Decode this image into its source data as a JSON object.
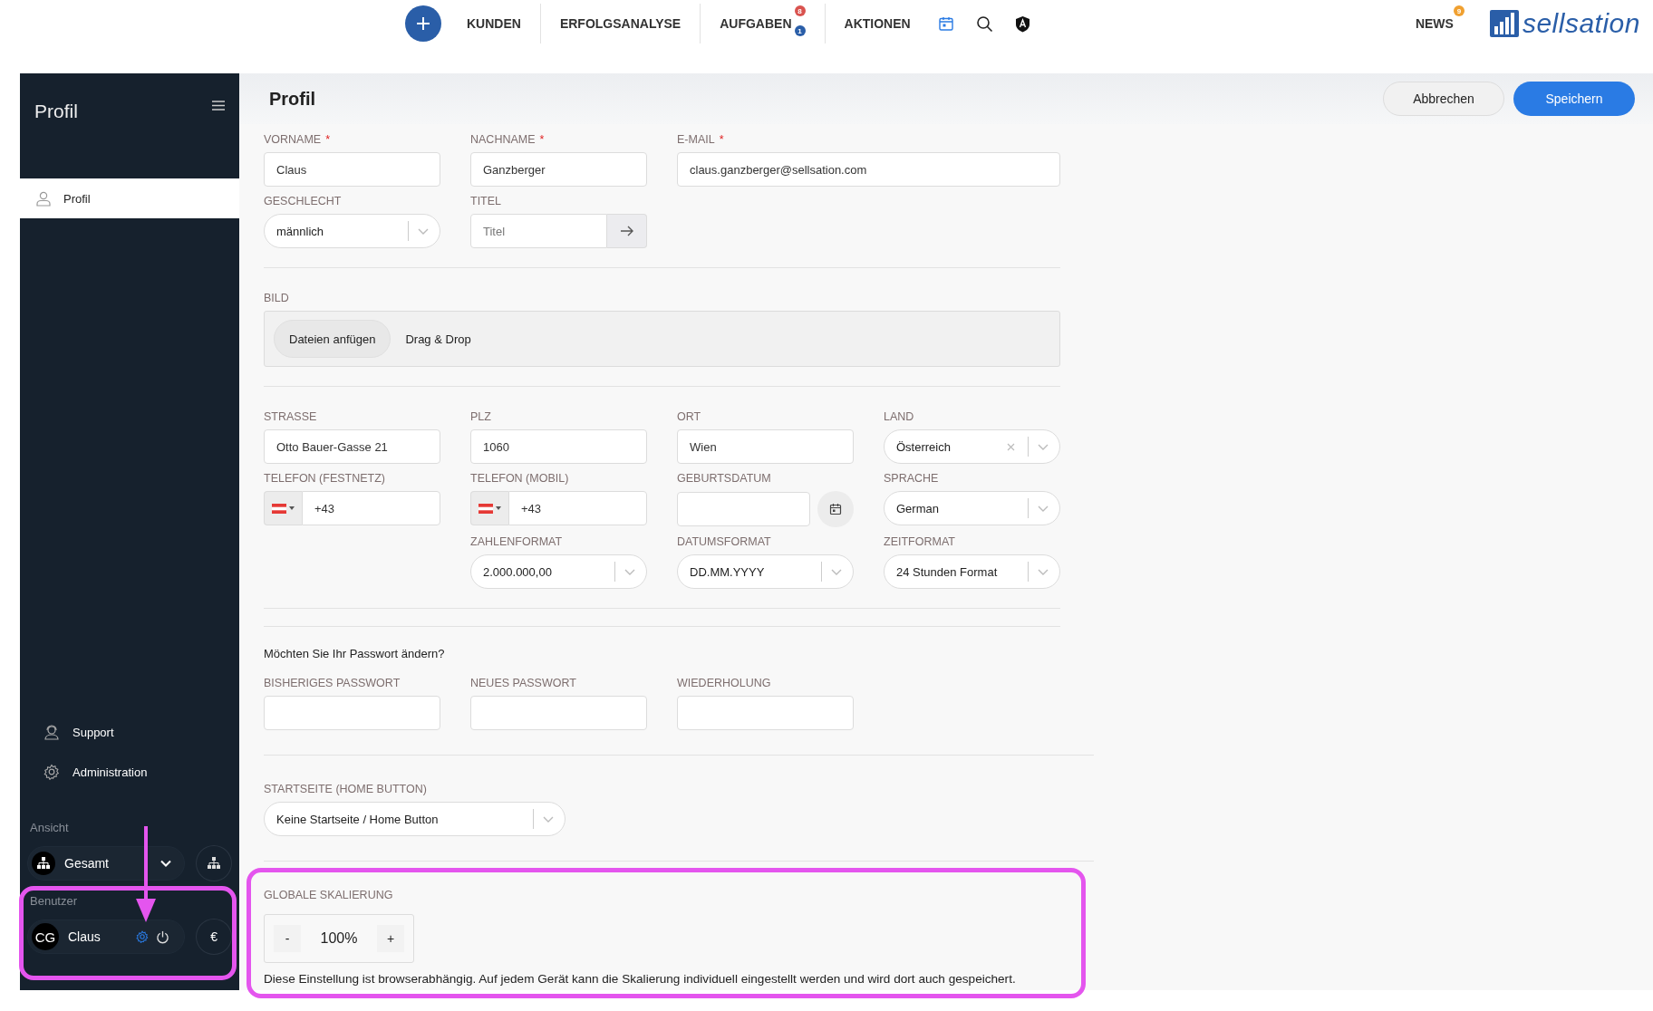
{
  "top_nav": {
    "items": [
      {
        "label": "KUNDEN"
      },
      {
        "label": "ERFOLGSANALYSE"
      },
      {
        "label": "AUFGABEN",
        "badges": [
          {
            "count": "8",
            "color": "#d9534f"
          },
          {
            "count": "1",
            "color": "#2a5ea8"
          }
        ]
      },
      {
        "label": "AKTIONEN"
      }
    ],
    "news": {
      "label": "NEWS",
      "badge": "9"
    },
    "logo": "sellsation"
  },
  "sidebar": {
    "title": "Profil",
    "items": [
      {
        "label": "Profil",
        "selected": true
      }
    ],
    "links": [
      {
        "label": "Support",
        "kind": "support"
      },
      {
        "label": "Administration",
        "kind": "admin"
      }
    ],
    "view_label": "Ansicht",
    "view_value": "Gesamt",
    "user_label": "Benutzer",
    "user_initials": "CG",
    "user_name": "Claus",
    "currency": "€"
  },
  "header": {
    "title": "Profil",
    "buttons": [
      {
        "label": "Abbrechen",
        "kind": "secondary"
      },
      {
        "label": "Speichern",
        "kind": "primary"
      }
    ]
  },
  "personal": {
    "rows": [
      [
        {
          "label": "VORNAME",
          "required_mark": "*",
          "kind": "text",
          "value": "Claus"
        },
        {
          "label": "NACHNAME",
          "required_mark": "*",
          "kind": "text",
          "value": "Ganzberger"
        },
        {
          "label": "E-MAIL",
          "required_mark": "*",
          "kind": "email",
          "value": "claus.ganzberger@sellsation.com"
        }
      ],
      [
        {
          "label": "GESCHLECHT",
          "kind": "select",
          "value": "männlich"
        },
        {
          "label": "TITEL",
          "kind": "title",
          "placeholder": "Titel"
        }
      ]
    ]
  },
  "picture": {
    "label": "BILD",
    "button": "Dateien anfügen",
    "hint": "Drag & Drop"
  },
  "address": {
    "rows": [
      [
        {
          "label": "STRASSE",
          "kind": "text",
          "value": "Otto Bauer-Gasse 21"
        },
        {
          "label": "PLZ",
          "kind": "text",
          "value": "1060"
        },
        {
          "label": "ORT",
          "kind": "text",
          "value": "Wien"
        },
        {
          "label": "LAND",
          "kind": "select-clear",
          "value": "Österreich"
        }
      ],
      [
        {
          "label": "TELEFON (FESTNETZ)",
          "kind": "phone",
          "value": "+43"
        },
        {
          "label": "TELEFON (MOBIL)",
          "kind": "phone",
          "value": "+43"
        },
        {
          "label": "GEBURTSDATUM",
          "kind": "date"
        },
        {
          "label": "SPRACHE",
          "kind": "select",
          "value": "German"
        }
      ],
      [
        "",
        {
          "label": "ZAHLENFORMAT",
          "kind": "select",
          "value": "2.000.000,00"
        },
        {
          "label": "DATUMSFORMAT",
          "kind": "select",
          "value": "DD.MM.YYYY"
        },
        {
          "label": "ZEITFORMAT",
          "kind": "select",
          "value": "24 Stunden Format"
        }
      ]
    ]
  },
  "password": {
    "question": "Möchten Sie Ihr Passwort ändern?",
    "fields": [
      {
        "label": "BISHERIGES PASSWORT"
      },
      {
        "label": "NEUES PASSWORT"
      },
      {
        "label": "WIEDERHOLUNG"
      }
    ]
  },
  "start_page": {
    "label": "STARTSEITE (HOME BUTTON)",
    "value": "Keine Startseite / Home Button"
  },
  "scaling": {
    "label": "GLOBALE SKALIERUNG",
    "decrease": "-",
    "value": "100%",
    "increase": "+",
    "note": "Diese Einstellung ist browserabhängig. Auf jedem Gerät kann die Skalierung individuell eingestellt werden und wird dort auch gespeichert."
  }
}
